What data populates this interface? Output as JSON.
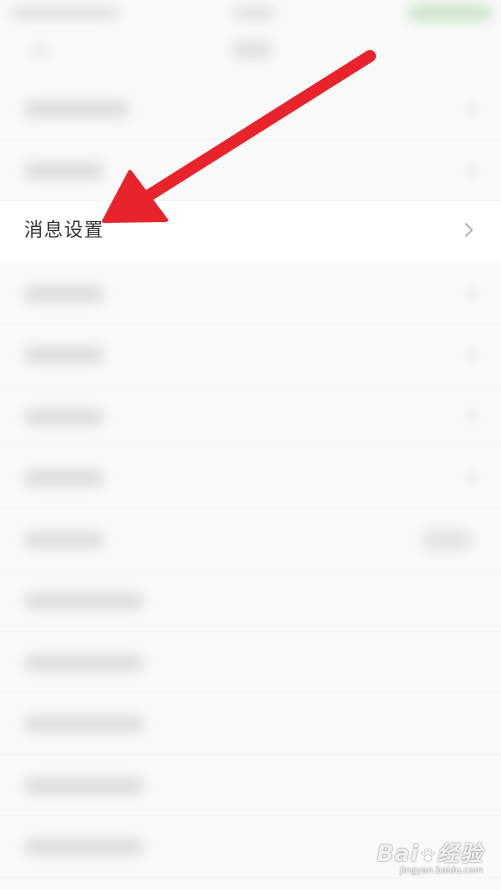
{
  "settings": {
    "highlighted_item": {
      "label": "消息设置"
    }
  },
  "watermark": {
    "logo_text_left": "Bai",
    "logo_text_right": "经验",
    "url": "jingyan.baidu.com"
  },
  "colors": {
    "arrow": "#e8232c",
    "label": "#333333",
    "chevron": "#b3b3b3"
  },
  "icons": {
    "chevron": "chevron-right-icon",
    "arrow": "arrow-annotation-icon"
  }
}
